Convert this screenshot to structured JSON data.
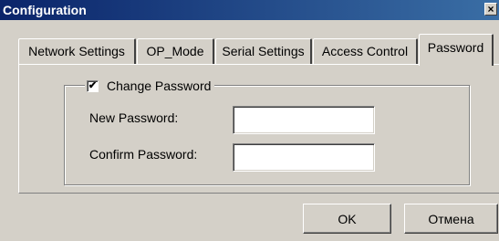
{
  "window": {
    "title": "Configuration",
    "close_glyph": "×"
  },
  "tabs": [
    {
      "label": "Network Settings",
      "active": false
    },
    {
      "label": "OP_Mode",
      "active": false
    },
    {
      "label": "Serial Settings",
      "active": false
    },
    {
      "label": "Access Control",
      "active": false
    },
    {
      "label": "Password",
      "active": true
    }
  ],
  "password_group": {
    "checkbox_label": "Change Password",
    "checkbox_checked": true,
    "checkmark_glyph": "✔",
    "new_password_label": "New Password:",
    "new_password_value": "",
    "confirm_password_label": "Confirm Password:",
    "confirm_password_value": ""
  },
  "buttons": {
    "ok": "OK",
    "cancel": "Отмена"
  },
  "colors": {
    "titlebar_start": "#0a246a",
    "titlebar_end": "#3a6ea5",
    "face": "#d4d0c8"
  }
}
